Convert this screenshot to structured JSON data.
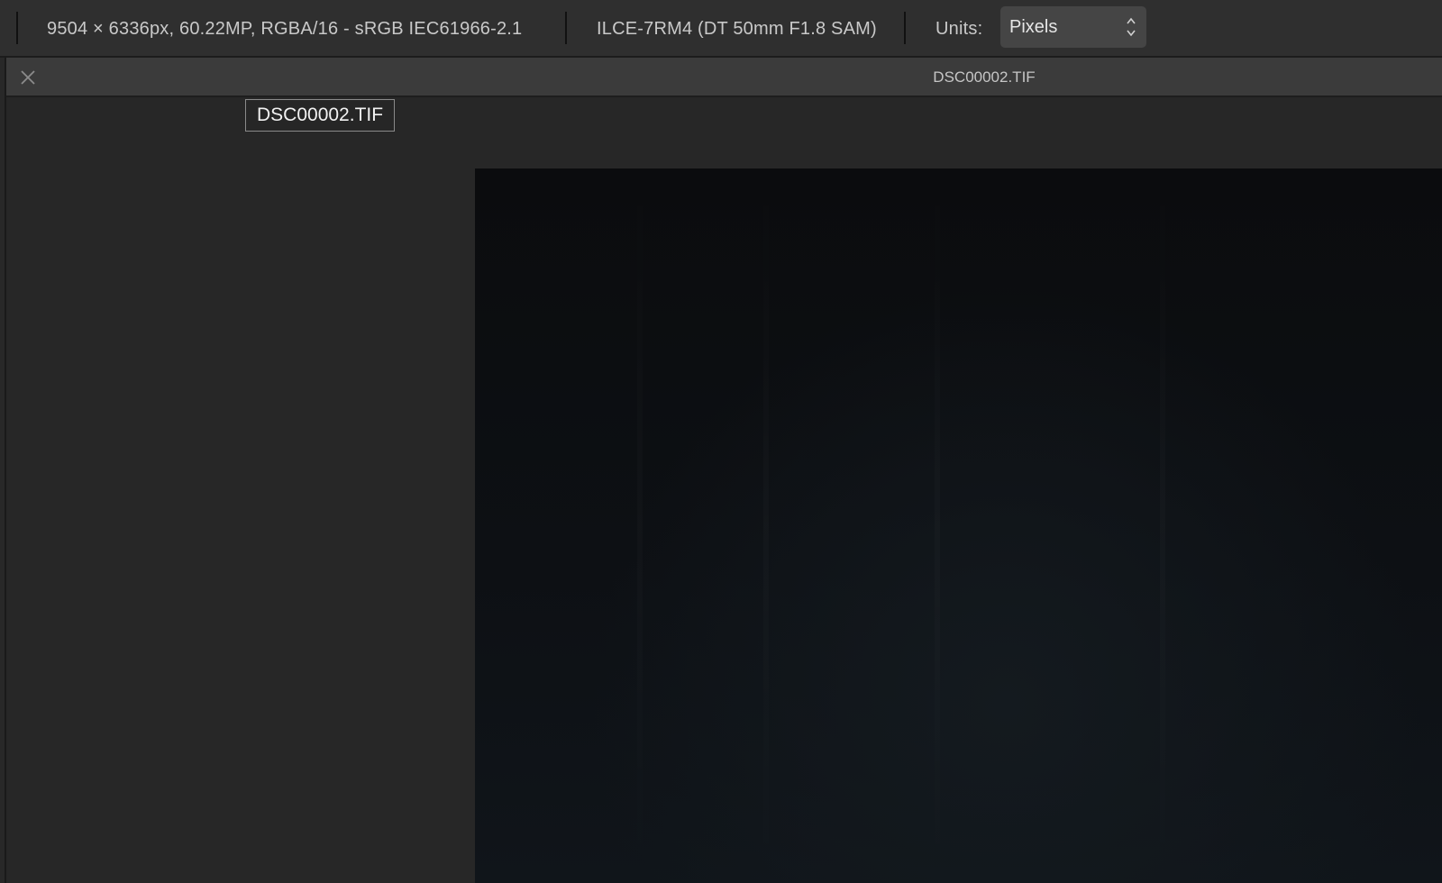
{
  "toolbar": {
    "image_info": "9504 × 6336px, 60.22MP, RGBA/16 - sRGB IEC61966-2.1",
    "camera_info": "ILCE-7RM4 (DT 50mm F1.8 SAM)",
    "units_label": "Units:",
    "units_value": "Pixels"
  },
  "document": {
    "title": "DSC00002.TIF",
    "tooltip": "DSC00002.TIF"
  },
  "icons": {
    "close": "close-icon",
    "units_chevron": "chevron-updown-icon"
  },
  "colors": {
    "toolbar_bg": "#2f2f2f",
    "tabbar_bg": "#3b3b3b",
    "workspace_bg": "#272727",
    "photo_bg": "#0c0f12"
  }
}
